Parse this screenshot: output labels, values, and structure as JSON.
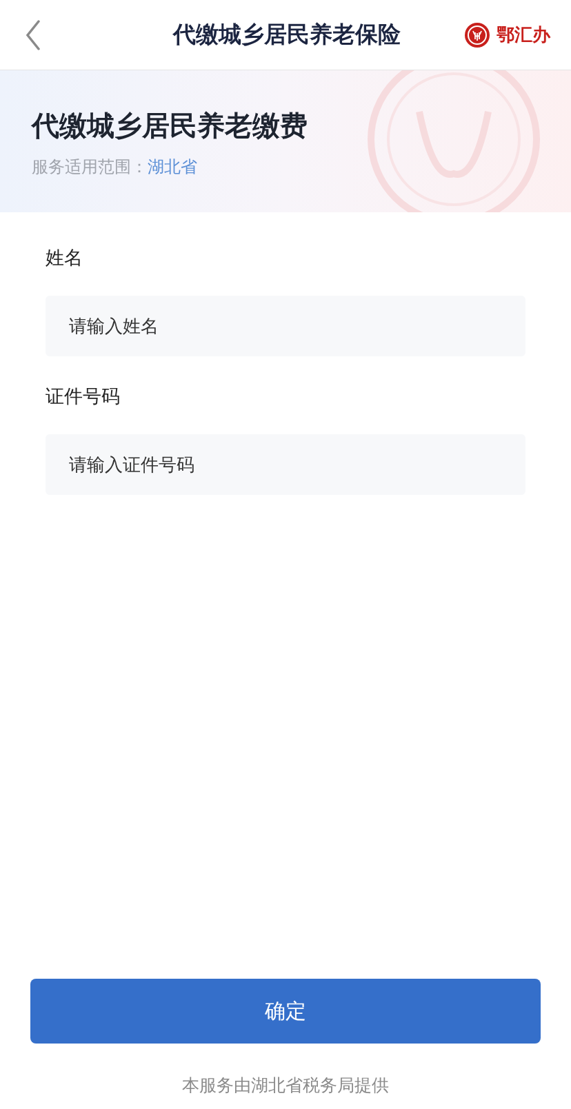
{
  "nav": {
    "title": "代缴城乡居民养老保险",
    "brand": "鄂汇办"
  },
  "header": {
    "title": "代缴城乡居民养老缴费",
    "scope_label": "服务适用范围：",
    "scope_value": "湖北省"
  },
  "fields": [
    {
      "label": "姓名",
      "placeholder": "请输入姓名"
    },
    {
      "label": "证件号码",
      "placeholder": "请输入证件号码"
    }
  ],
  "submit": "确定",
  "footer": "本服务由湖北省税务局提供"
}
